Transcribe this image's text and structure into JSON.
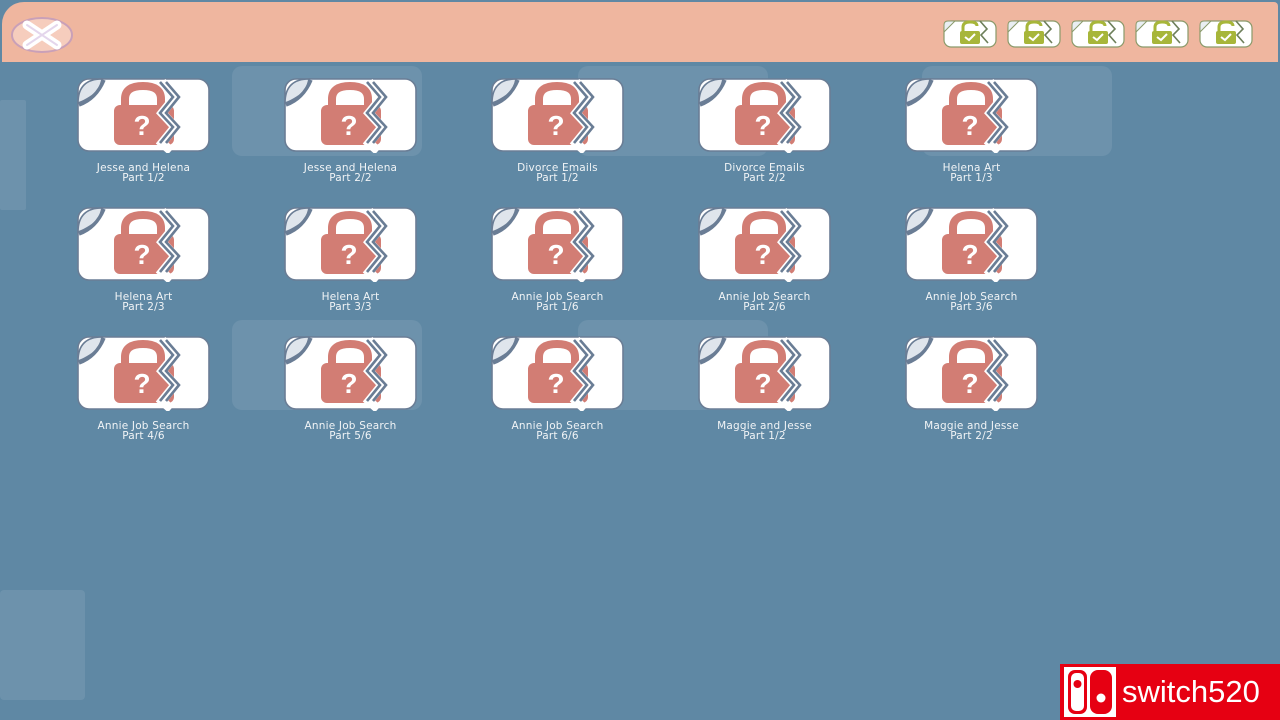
{
  "header": {
    "close_icon": "close-x-icon",
    "tray": [
      {
        "icon": "unlocked-email-badge-icon"
      },
      {
        "icon": "unlocked-email-badge-icon"
      },
      {
        "icon": "unlocked-email-badge-icon"
      },
      {
        "icon": "unlocked-email-badge-icon"
      },
      {
        "icon": "unlocked-email-badge-icon"
      }
    ]
  },
  "files": [
    {
      "name": "Jesse and Helena",
      "part": "Part 1/2",
      "icon": "locked-file-icon"
    },
    {
      "name": "Jesse and Helena",
      "part": "Part 2/2",
      "icon": "locked-file-icon"
    },
    {
      "name": "Divorce Emails",
      "part": "Part 1/2",
      "icon": "locked-file-icon"
    },
    {
      "name": "Divorce Emails",
      "part": "Part 2/2",
      "icon": "locked-file-icon"
    },
    {
      "name": "Helena Art",
      "part": "Part 1/3",
      "icon": "locked-file-icon"
    },
    {
      "name": "Helena Art",
      "part": "Part 2/3",
      "icon": "locked-file-icon"
    },
    {
      "name": "Helena Art",
      "part": "Part 3/3",
      "icon": "locked-file-icon"
    },
    {
      "name": "Annie Job Search",
      "part": "Part 1/6",
      "icon": "locked-file-icon"
    },
    {
      "name": "Annie Job Search",
      "part": "Part 2/6",
      "icon": "locked-file-icon"
    },
    {
      "name": "Annie Job Search",
      "part": "Part 3/6",
      "icon": "locked-file-icon"
    },
    {
      "name": "Annie Job Search",
      "part": "Part 4/6",
      "icon": "locked-file-icon"
    },
    {
      "name": "Annie Job Search",
      "part": "Part 5/6",
      "icon": "locked-file-icon"
    },
    {
      "name": "Annie Job Search",
      "part": "Part 6/6",
      "icon": "locked-file-icon"
    },
    {
      "name": "Maggie and Jesse",
      "part": "Part 1/2",
      "icon": "locked-file-icon"
    },
    {
      "name": "Maggie and Jesse",
      "part": "Part 2/2",
      "icon": "locked-file-icon"
    }
  ],
  "watermark": {
    "text": "switch520"
  },
  "colors": {
    "background": "#5f88a4",
    "header": "#efb69f",
    "lock": "#d27d74",
    "tile": "#ffffff",
    "tile_outline": "#6a7d95",
    "badge": "#a7b63a",
    "watermark": "#e60012"
  }
}
